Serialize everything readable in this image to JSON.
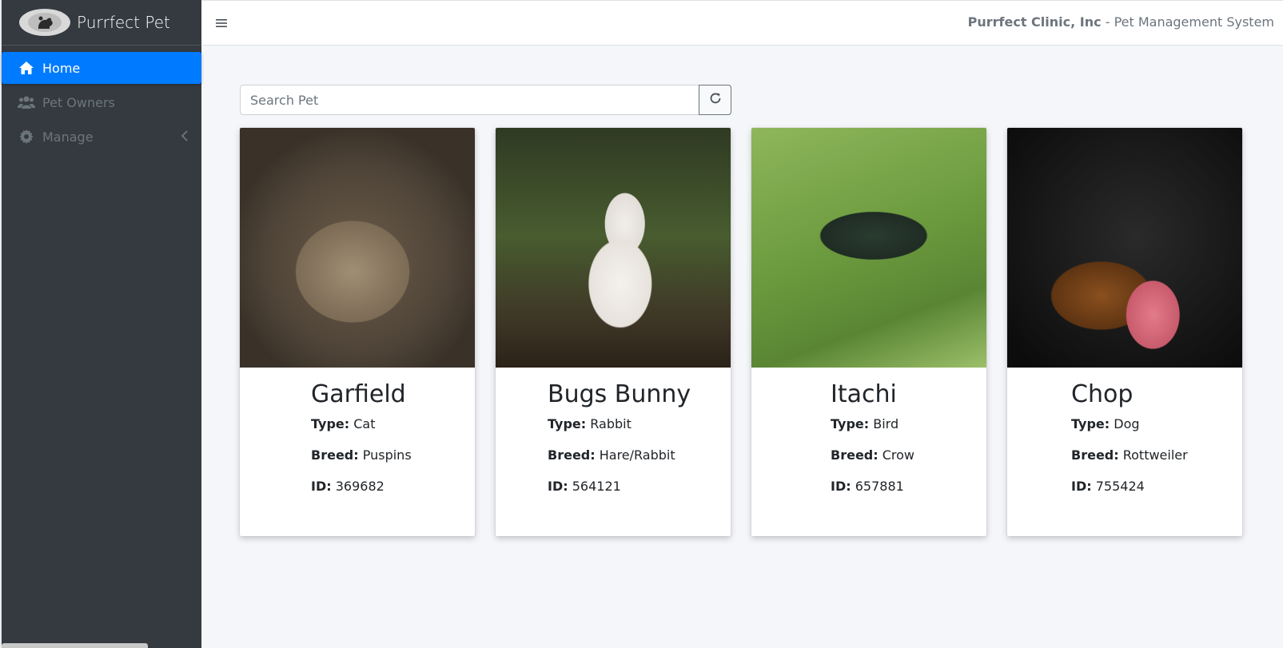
{
  "sidebar": {
    "brand": "Purrfect Pet",
    "items": [
      {
        "label": "Home",
        "icon": "home-icon",
        "active": true
      },
      {
        "label": "Pet Owners",
        "icon": "users-icon",
        "active": false
      },
      {
        "label": "Manage",
        "icon": "gear-icon",
        "active": false
      }
    ]
  },
  "header": {
    "company": "Purrfect Clinic, Inc",
    "separator": " - ",
    "system": "Pet Management System"
  },
  "search": {
    "placeholder": "Search Pet",
    "value": ""
  },
  "labels": {
    "type": "Type:",
    "breed": "Breed:",
    "id": "ID:"
  },
  "pets": [
    {
      "name": "Garfield",
      "type": "Cat",
      "breed": "Puspins",
      "id": "369682"
    },
    {
      "name": "Bugs Bunny",
      "type": "Rabbit",
      "breed": "Hare/Rabbit",
      "id": "564121"
    },
    {
      "name": "Itachi",
      "type": "Bird",
      "breed": "Crow",
      "id": "657881"
    },
    {
      "name": "Chop",
      "type": "Dog",
      "breed": "Rottweiler",
      "id": "755424"
    }
  ],
  "colors": {
    "sidebar_bg": "#343a40",
    "accent": "#007bff",
    "content_bg": "#f4f6f9"
  }
}
